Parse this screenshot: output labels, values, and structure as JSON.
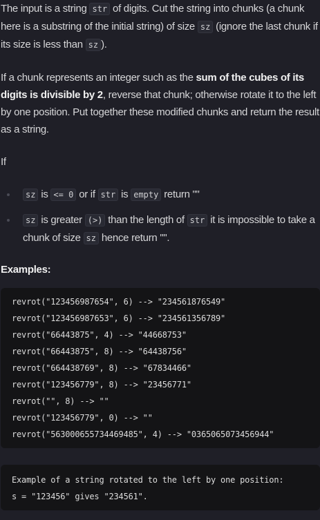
{
  "intro": {
    "p1": [
      "The input is a string ",
      "str",
      " of digits. Cut the string into chunks (a chunk here is a substring of the initial string) of size ",
      "sz",
      " (ignore the last chunk if its size is less than ",
      "sz",
      ")."
    ],
    "p2": [
      "If a chunk represents an integer such as the ",
      "sum of the cubes of its digits is divisible by 2",
      ", reverse that chunk; otherwise rotate it to the left by one position. Put together these modified chunks and return the result as a string."
    ],
    "p3": "If"
  },
  "conditions": [
    [
      "sz",
      " is ",
      "<= 0",
      " or if ",
      "str",
      " is ",
      "empty",
      " return \"\""
    ],
    [
      "sz",
      " is greater ",
      "(>)",
      " than the length of ",
      "str",
      " it is impossible to take a chunk of size ",
      "sz",
      " hence return \"\"."
    ]
  ],
  "examples_heading": "Examples:",
  "examples": [
    "revrot(\"123456987654\", 6) --> \"234561876549\"",
    "revrot(\"123456987653\", 6) --> \"234561356789\"",
    "revrot(\"66443875\", 4) --> \"44668753\"",
    "revrot(\"66443875\", 8) --> \"64438756\"",
    "revrot(\"664438769\", 8) --> \"67834466\"",
    "revrot(\"123456779\", 8) --> \"23456771\"",
    "revrot(\"\", 8) --> \"\"",
    "revrot(\"123456779\", 0) --> \"\"",
    "revrot(\"563000655734469485\", 4) --> \"0365065073456944\""
  ],
  "rotation_example": [
    "Example of a string rotated to the left by one position:",
    "s = \"123456\" gives \"234561\"."
  ]
}
